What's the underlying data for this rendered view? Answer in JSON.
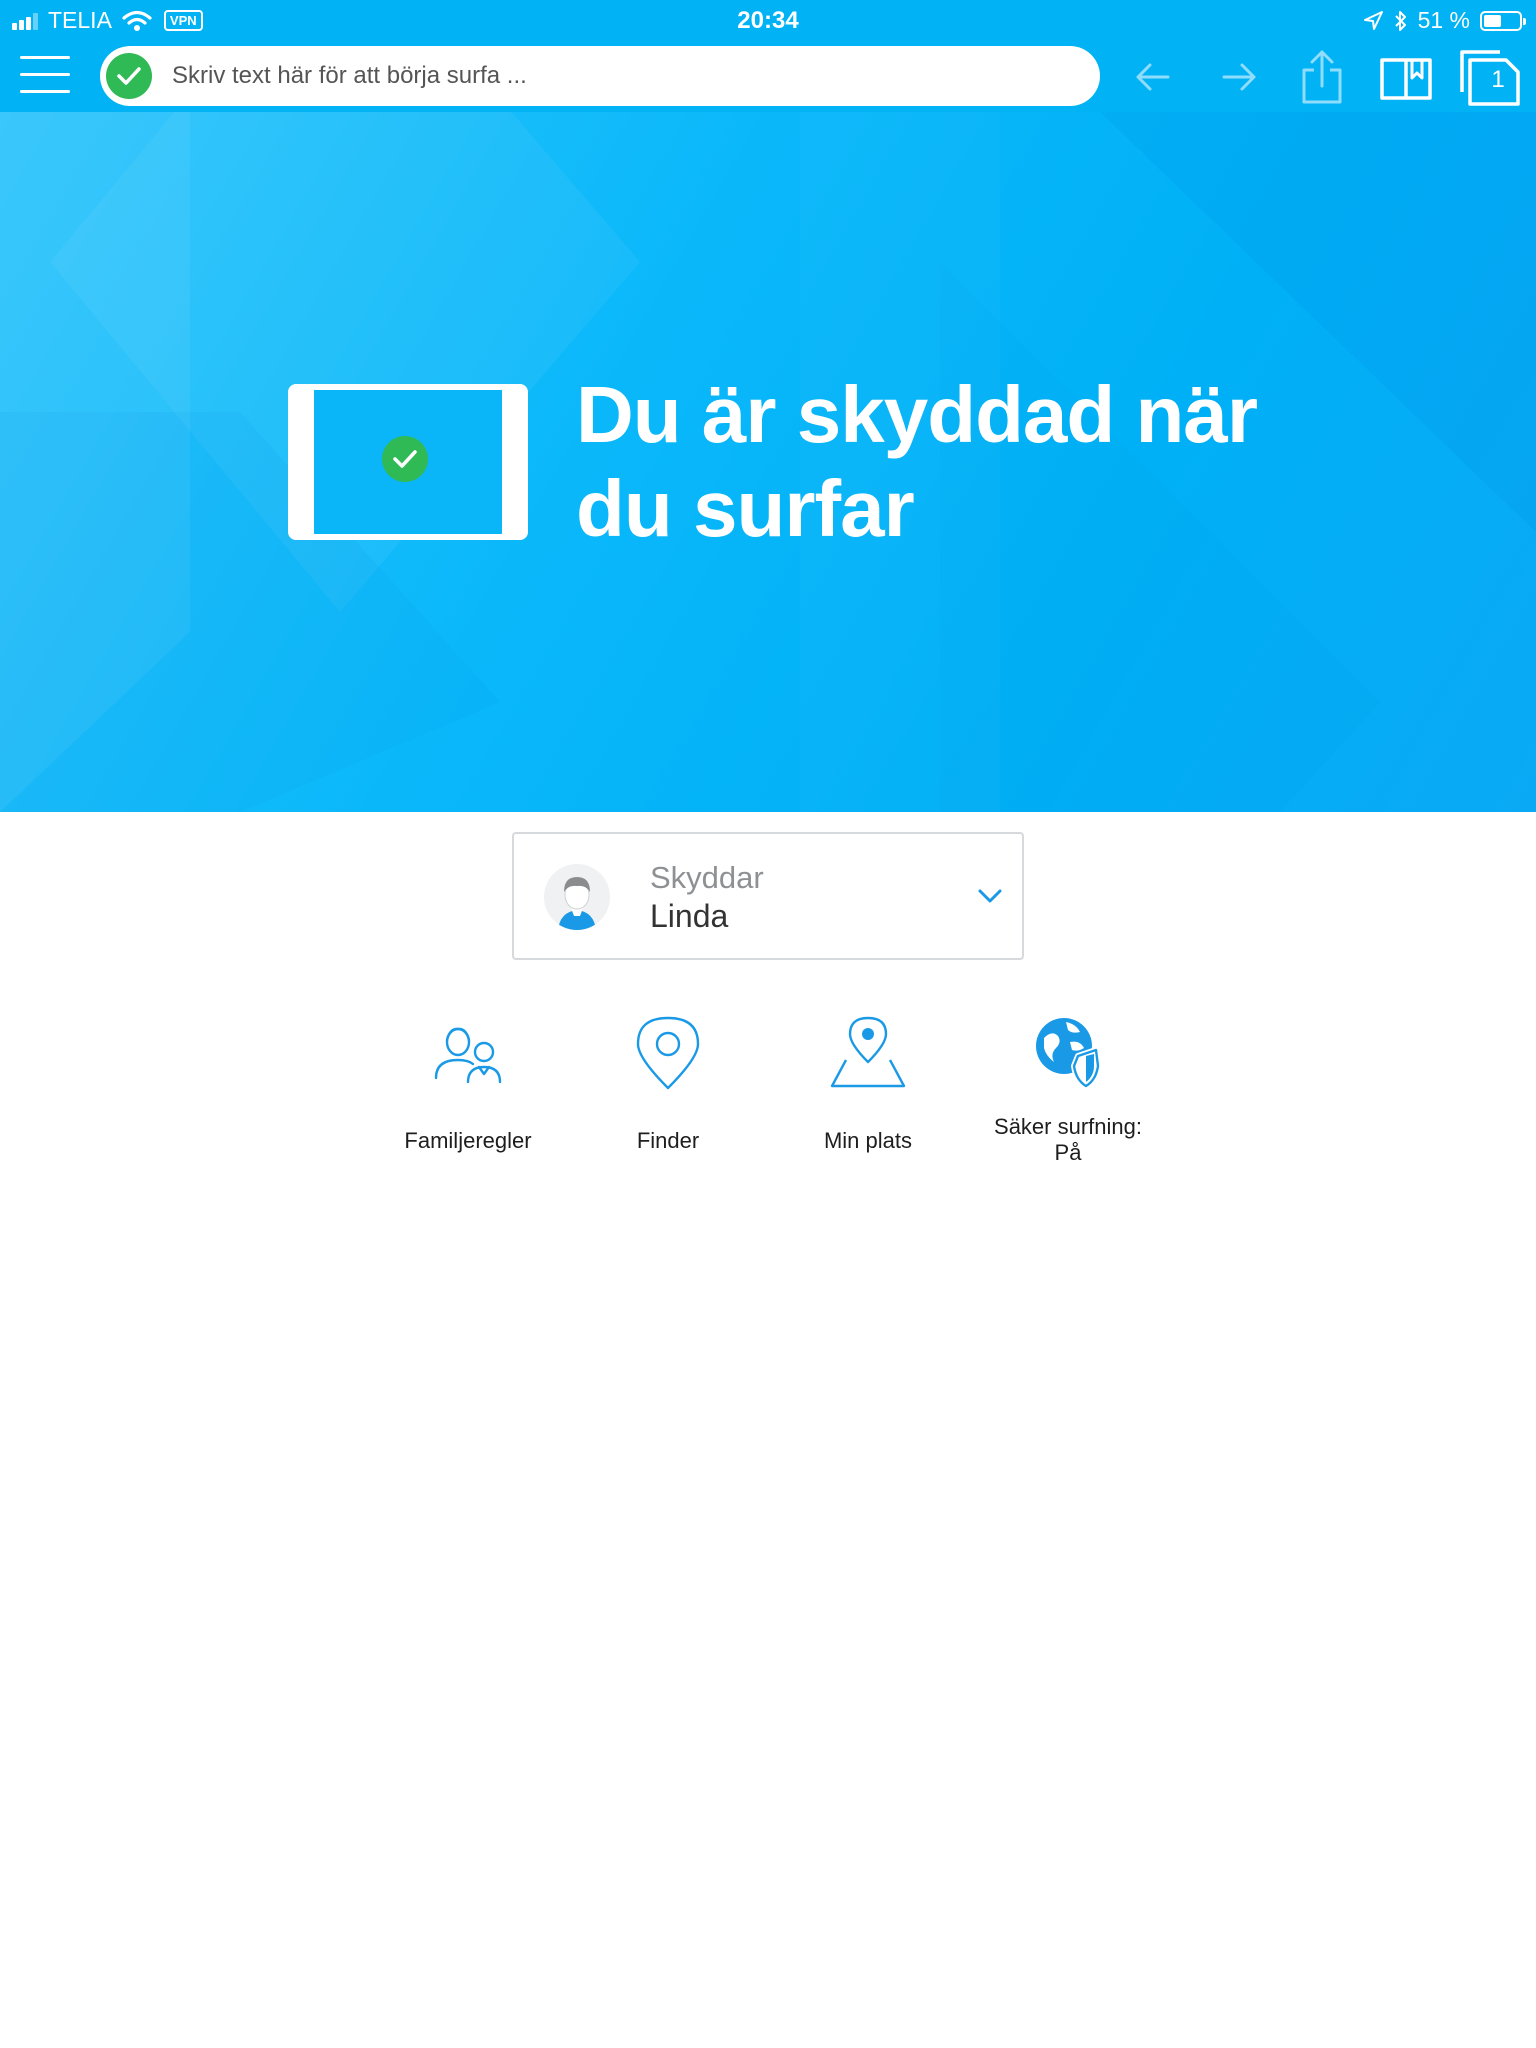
{
  "status_bar": {
    "carrier": "TELIA",
    "vpn_label": "VPN",
    "time": "20:34",
    "battery_percent": "51 %",
    "battery_level": 0.51
  },
  "toolbar": {
    "url_placeholder": "Skriv text här för att börja surfa ...",
    "tab_count": "1"
  },
  "hero": {
    "headline_line1": "Du är skyddad när",
    "headline_line2": "du surfar"
  },
  "profile": {
    "label": "Skyddar",
    "name": "Linda"
  },
  "actions": [
    {
      "label": "Familjeregler",
      "icon": "family-icon"
    },
    {
      "label": "Finder",
      "icon": "location-pin-icon"
    },
    {
      "label": "Min plats",
      "icon": "map-pin-icon"
    },
    {
      "label_line1": "Säker surfning:",
      "label_line2": "På",
      "icon": "globe-shield-icon"
    }
  ],
  "colors": {
    "brand_blue": "#01b3f5",
    "success_green": "#2fba55",
    "icon_blue": "#1a9ae6"
  }
}
